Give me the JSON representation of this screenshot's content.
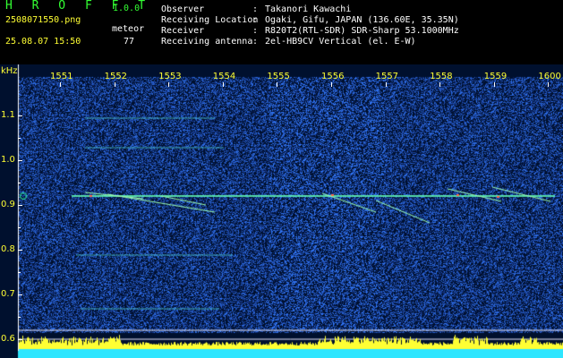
{
  "header": {
    "app_title": "H R O F F T",
    "version": "1.0.0",
    "file_name": "2508071550.png",
    "datetime": "25.08.07 15:50",
    "meteor_label": "meteor",
    "meteor_count": "77",
    "fields": [
      {
        "label": "Observer",
        "value": "Takanori Kawachi"
      },
      {
        "label": "Receiving Location",
        "value": "Ogaki, Gifu, JAPAN (136.60E, 35.35N)"
      },
      {
        "label": "Receiver",
        "value": "R820T2(RTL-SDR) SDR-Sharp 53.1000MHz"
      },
      {
        "label": "Receiving antenna",
        "value": "2el-HB9CV Vertical (el. E-W)"
      }
    ],
    "separator": ":"
  },
  "chart_data": {
    "type": "heatmap",
    "ylabel": "kHz",
    "y_ticks": [
      "1.1",
      "1.0",
      "0.9",
      "0.8",
      "0.7",
      "0.6"
    ],
    "x_ticks": [
      "1551",
      "1552",
      "1553",
      "1554",
      "1555",
      "1556",
      "1557",
      "1558",
      "1559",
      "1600"
    ],
    "carrier_khz": 0.92,
    "colors": {
      "background": "#00102e",
      "signal": "#ffff33",
      "echo": "#2eff9f",
      "baseline": "#2ee6ff"
    }
  }
}
